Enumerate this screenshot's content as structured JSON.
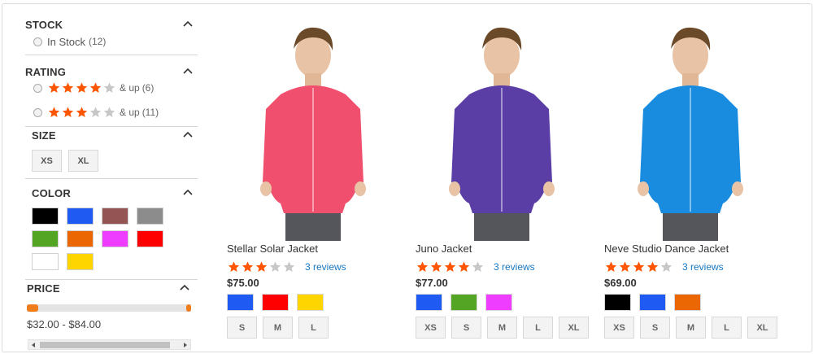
{
  "filters": {
    "stock": {
      "title": "STOCK",
      "options": [
        {
          "label": "In Stock",
          "count": "(12)"
        }
      ]
    },
    "rating": {
      "title": "RATING",
      "options": [
        {
          "stars": 4,
          "suffix": "& up",
          "count": "(6)"
        },
        {
          "stars": 3,
          "suffix": "& up",
          "count": "(11)"
        }
      ]
    },
    "size": {
      "title": "SIZE",
      "options": [
        "XS",
        "XL"
      ]
    },
    "color": {
      "title": "COLOR",
      "swatches": [
        "#000000",
        "#1f5bf3",
        "#945454",
        "#8c8c8c",
        "#53a523",
        "#eb6703",
        "#ef3dff",
        "#ff0000",
        "#ffffff",
        "#ffd500"
      ]
    },
    "price": {
      "title": "PRICE",
      "range": "$32.00 - $84.00"
    }
  },
  "products": [
    {
      "name": "Stellar Solar Jacket",
      "rating": 3,
      "reviews": "3 reviews",
      "price": "$75.00",
      "colors": [
        "#1f5bf3",
        "#ff0000",
        "#ffd500"
      ],
      "sizes": [
        "S",
        "M",
        "L"
      ],
      "garment_color": "#f0506e"
    },
    {
      "name": "Juno Jacket",
      "rating": 4,
      "reviews": "3 reviews",
      "price": "$77.00",
      "colors": [
        "#1f5bf3",
        "#53a523",
        "#ef3dff"
      ],
      "sizes": [
        "XS",
        "S",
        "M",
        "L",
        "XL"
      ],
      "garment_color": "#5a3ea6"
    },
    {
      "name": "Neve Studio Dance Jacket",
      "rating": 4,
      "reviews": "3 reviews",
      "price": "$69.00",
      "colors": [
        "#000000",
        "#1f5bf3",
        "#eb6703"
      ],
      "sizes": [
        "XS",
        "S",
        "M",
        "L",
        "XL"
      ],
      "garment_color": "#1a8ce0"
    }
  ],
  "theme": {
    "star_on": "#ff5501",
    "star_off": "#c7c7c7",
    "link": "#1979c3",
    "accent": "#f07c1b"
  }
}
